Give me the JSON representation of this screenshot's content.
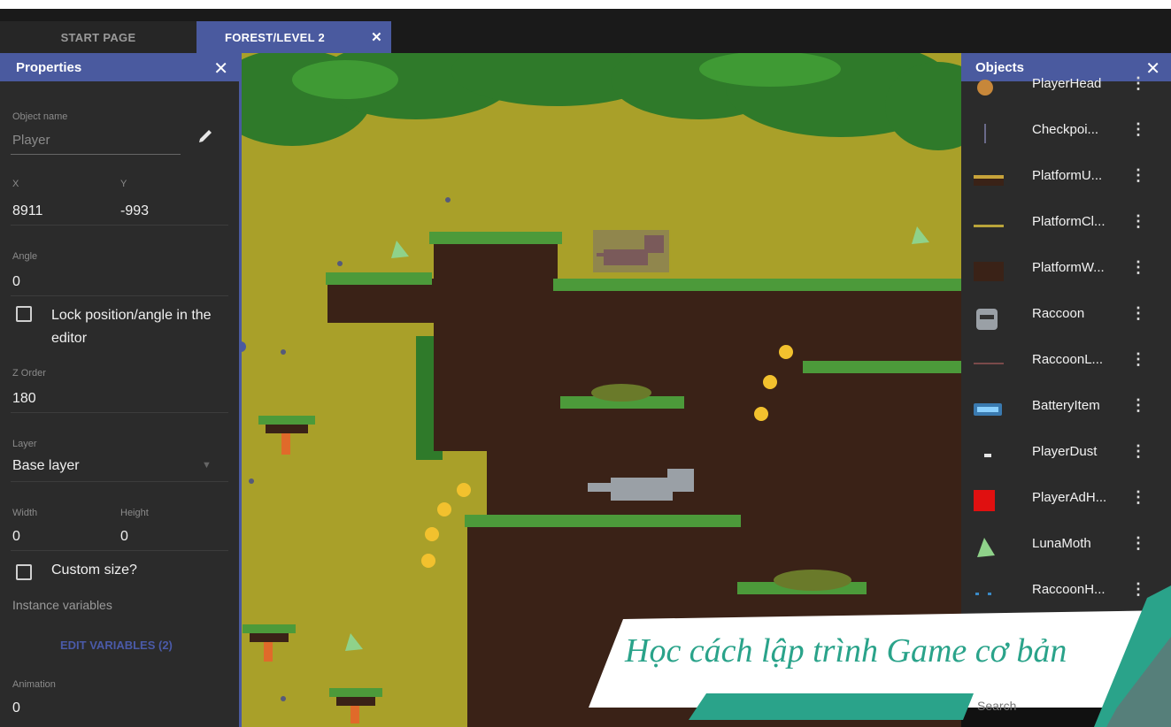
{
  "tabs": [
    {
      "label": "START PAGE",
      "active": false
    },
    {
      "label": "FOREST/LEVEL 2",
      "active": true
    }
  ],
  "tab_close_icon": "close-icon",
  "properties": {
    "title": "Properties",
    "object_name_label": "Object name",
    "object_name_placeholder": "Player",
    "x_label": "X",
    "x_value": "8911",
    "y_label": "Y",
    "y_value": "-993",
    "angle_label": "Angle",
    "angle_value": "0",
    "lock_label": "Lock position/angle in the editor",
    "z_order_label": "Z Order",
    "z_order_value": "180",
    "layer_label": "Layer",
    "layer_value": "Base layer",
    "width_label": "Width",
    "width_value": "0",
    "height_label": "Height",
    "height_value": "0",
    "custom_size_label": "Custom size?",
    "instance_variables_label": "Instance variables",
    "edit_variables_label": "EDIT VARIABLES (2)",
    "animation_label": "Animation",
    "animation_value": "0"
  },
  "objects": {
    "title": "Objects",
    "items": [
      {
        "name": "PlayerHead",
        "icon": "player-head-icon"
      },
      {
        "name": "Checkpoi...",
        "icon": "checkpoint-icon"
      },
      {
        "name": "PlatformU...",
        "icon": "platform-icon"
      },
      {
        "name": "PlatformCl...",
        "icon": "platform-icon"
      },
      {
        "name": "PlatformW...",
        "icon": "platform-wall-icon"
      },
      {
        "name": "Raccoon",
        "icon": "raccoon-icon"
      },
      {
        "name": "RaccoonL...",
        "icon": "raccoon-line-icon"
      },
      {
        "name": "BatteryItem",
        "icon": "battery-icon"
      },
      {
        "name": "PlayerDust",
        "icon": "dust-icon"
      },
      {
        "name": "PlayerAdH...",
        "icon": "red-square-icon"
      },
      {
        "name": "LunaMoth",
        "icon": "moth-icon"
      },
      {
        "name": "RaccoonH...",
        "icon": "raccoon-h-icon"
      }
    ],
    "search_placeholder": "Search"
  },
  "banner": {
    "text": "Học cách lập trình Game cơ bản"
  },
  "colors": {
    "accent": "#4a5a9f",
    "panel_bg": "#2b2b2b",
    "sky": "#a9a029",
    "dirt": "#3a2217",
    "grass": "#4c9a3a",
    "coin": "#f2c12e",
    "banner_teal": "#2aa38a"
  }
}
